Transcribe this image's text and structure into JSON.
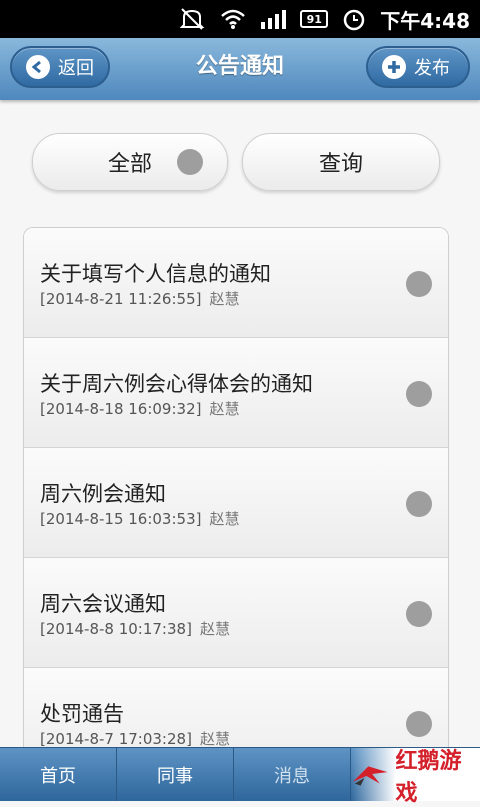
{
  "status_bar": {
    "battery": "91",
    "time": "下午4:48"
  },
  "header": {
    "back_label": "返回",
    "title": "公告通知",
    "publish_label": "发布"
  },
  "filters": {
    "all_label": "全部",
    "query_label": "查询"
  },
  "notices": [
    {
      "title": "关于填写个人信息的通知",
      "datetime": "[2014-8-21 11:26:55]",
      "author": "赵慧"
    },
    {
      "title": "关于周六例会心得体会的通知",
      "datetime": "[2014-8-18 16:09:32]",
      "author": "赵慧"
    },
    {
      "title": "周六例会通知",
      "datetime": "[2014-8-15 16:03:53]",
      "author": "赵慧"
    },
    {
      "title": "周六会议通知",
      "datetime": "[2014-8-8 10:17:38]",
      "author": "赵慧"
    },
    {
      "title": "处罚通告",
      "datetime": "[2014-8-7 17:03:28]",
      "author": "赵慧"
    }
  ],
  "tabs": {
    "home": "首页",
    "colleagues": "同事",
    "messages": "消息"
  },
  "watermark": {
    "brand": "红鹅游戏"
  },
  "colors": {
    "header_top": "#8ab8dc",
    "header_bottom": "#4e88bd",
    "tabbar": "#2e679c",
    "indicator_dot": "#9e9e9e"
  }
}
